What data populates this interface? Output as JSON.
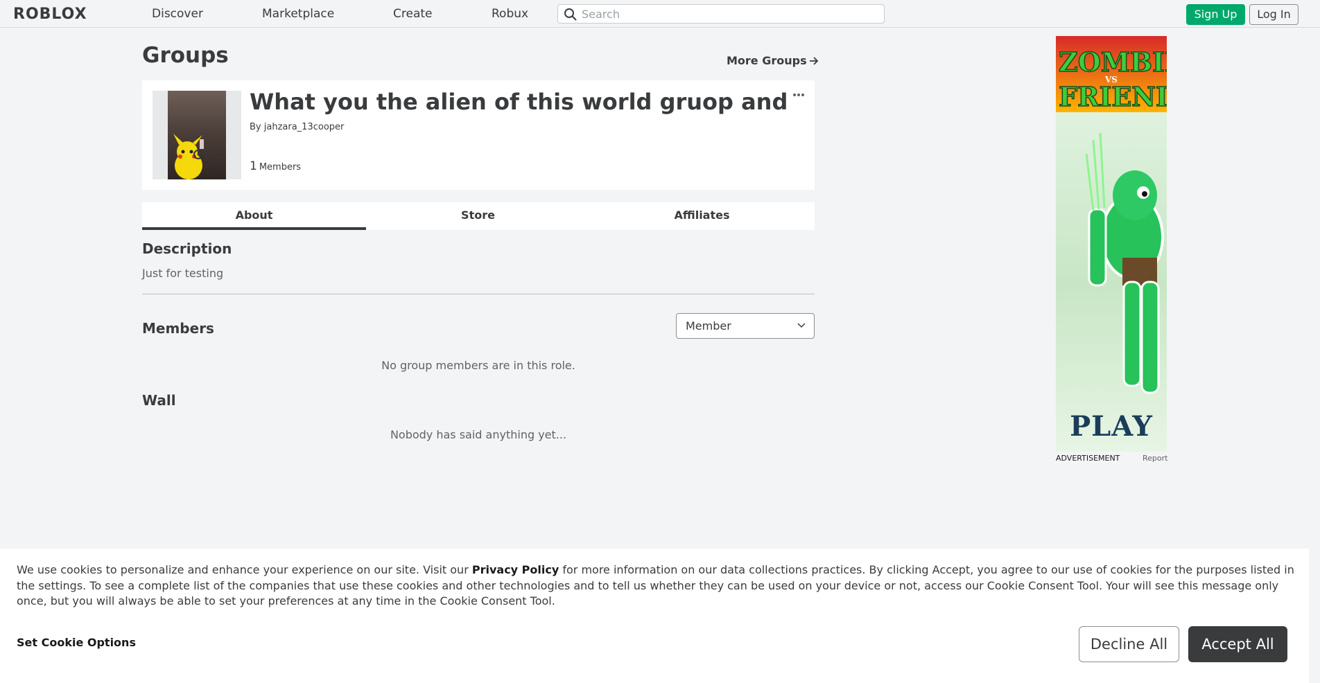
{
  "header": {
    "logo": "ROBLOX",
    "nav": [
      "Discover",
      "Marketplace",
      "Create",
      "Robux"
    ],
    "search_placeholder": "Search",
    "signup_label": "Sign Up",
    "login_label": "Log In"
  },
  "page": {
    "title": "Groups",
    "more_groups": "More Groups"
  },
  "group": {
    "name": "What you the alien of this world gruop and ...",
    "by_prefix": "By",
    "owner": "jahzara_13cooper",
    "member_count": "1",
    "members_label": "Members"
  },
  "tabs": [
    "About",
    "Store",
    "Affiliates"
  ],
  "about": {
    "description_title": "Description",
    "description_text": "Just for testing",
    "members_title": "Members",
    "role_selected": "Member",
    "members_empty": "No group members are in this role.",
    "wall_title": "Wall",
    "wall_empty": "Nobody has said anything yet..."
  },
  "ad": {
    "title_line1": "ZOMBIE",
    "title_vs": "VS",
    "title_line2": "FRIEND",
    "play": "PLAY",
    "label": "ADVERTISEMENT",
    "report": "Report"
  },
  "cookie": {
    "text_before": "We use cookies to personalize and enhance your experience on our site. Visit our ",
    "privacy_link": "Privacy Policy",
    "text_after": " for more information on our data collections practices. By clicking Accept, you agree to our use of cookies for the purposes listed in the settings. To see a complete list of the companies that use these cookies and other technologies and to tell us whether they can be used on your device or not, access our Cookie Consent Tool. Your will see this message only once, but you will always be able to set your preferences at any time in the Cookie Consent Tool.",
    "set_options": "Set Cookie Options",
    "decline": "Decline All",
    "accept": "Accept All"
  },
  "colors": {
    "signup_green": "#00a86b",
    "accept_dark": "#393b3d",
    "background": "#f2f4f5"
  }
}
